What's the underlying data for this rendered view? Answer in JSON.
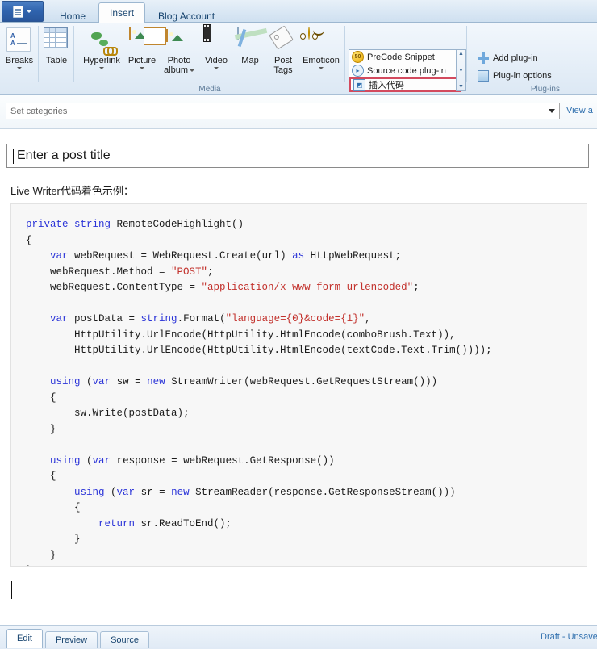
{
  "window": {
    "app_menu_icon": "document-menu-icon",
    "app_menu_caret": "chevron-down-icon"
  },
  "tabs": [
    {
      "label": "Home",
      "active": false
    },
    {
      "label": "Insert",
      "active": true
    },
    {
      "label": "Blog Account",
      "active": false
    }
  ],
  "ribbon": {
    "groups": [
      {
        "name": "breaks",
        "label": "",
        "items": [
          {
            "label": "Breaks",
            "icon": "breaks-icon",
            "dropdown": true
          }
        ]
      },
      {
        "name": "table",
        "label": "",
        "items": [
          {
            "label": "Table",
            "icon": "table-icon",
            "dropdown": false
          }
        ]
      },
      {
        "name": "media",
        "label": "Media",
        "items": [
          {
            "label": "Hyperlink",
            "icon": "hyperlink-globe-icon",
            "dropdown": true
          },
          {
            "label": "Picture",
            "icon": "picture-icon",
            "dropdown": true
          },
          {
            "label": "Photo album",
            "icon": "photo-album-icon",
            "dropdown": true
          },
          {
            "label": "Video",
            "icon": "video-icon",
            "dropdown": true
          },
          {
            "label": "Map",
            "icon": "map-icon",
            "dropdown": false
          },
          {
            "label": "Post Tags",
            "icon": "tag-icon",
            "dropdown": false
          },
          {
            "label": "Emoticon",
            "icon": "emoticon-icon",
            "dropdown": true
          }
        ]
      }
    ],
    "plugins": {
      "label": "Plug-ins",
      "gallery": [
        {
          "label": "PreCode Snippet",
          "icon": "precode-snippet-icon",
          "badge": "50",
          "selected": false
        },
        {
          "label": "Source code plug-in",
          "icon": "source-code-plugin-icon",
          "badge": "",
          "selected": false
        },
        {
          "label": "插入代码",
          "icon": "insert-code-plugin-icon",
          "badge": "",
          "selected": true
        }
      ],
      "scroll": {
        "up": "▲",
        "down": "▼",
        "more": "▼"
      },
      "buttons": [
        {
          "label": "Add plug-in",
          "icon": "add-plugin-icon"
        },
        {
          "label": "Plug-in options",
          "icon": "plugin-options-icon"
        }
      ]
    }
  },
  "categories": {
    "value": "Set categories",
    "dropdown_icon": "chevron-down-icon",
    "view_all_label": "View a"
  },
  "post": {
    "title_placeholder": "Enter a post title",
    "intro_text": "Live Writer代码着色示例：",
    "code_lines": [
      {
        "segments": [
          {
            "t": "private ",
            "c": "kw"
          },
          {
            "t": "string ",
            "c": "kw"
          },
          {
            "t": "RemoteCodeHighlight()",
            "c": ""
          }
        ]
      },
      {
        "segments": [
          {
            "t": "{",
            "c": ""
          }
        ]
      },
      {
        "segments": [
          {
            "t": "    ",
            "c": ""
          },
          {
            "t": "var ",
            "c": "kw"
          },
          {
            "t": "webRequest = WebRequest.Create(url) ",
            "c": ""
          },
          {
            "t": "as ",
            "c": "kw"
          },
          {
            "t": "HttpWebRequest;",
            "c": ""
          }
        ]
      },
      {
        "segments": [
          {
            "t": "    webRequest.Method = ",
            "c": ""
          },
          {
            "t": "\"POST\"",
            "c": "str"
          },
          {
            "t": ";",
            "c": ""
          }
        ]
      },
      {
        "segments": [
          {
            "t": "    webRequest.ContentType = ",
            "c": ""
          },
          {
            "t": "\"application/x-www-form-urlencoded\"",
            "c": "str"
          },
          {
            "t": ";",
            "c": ""
          }
        ]
      },
      {
        "segments": []
      },
      {
        "segments": [
          {
            "t": "    ",
            "c": ""
          },
          {
            "t": "var ",
            "c": "kw"
          },
          {
            "t": "postData = ",
            "c": ""
          },
          {
            "t": "string",
            "c": "kw"
          },
          {
            "t": ".Format(",
            "c": ""
          },
          {
            "t": "\"language={0}&code={1}\"",
            "c": "str"
          },
          {
            "t": ",",
            "c": ""
          }
        ]
      },
      {
        "segments": [
          {
            "t": "        HttpUtility.UrlEncode(HttpUtility.HtmlEncode(comboBrush.Text)),",
            "c": ""
          }
        ]
      },
      {
        "segments": [
          {
            "t": "        HttpUtility.UrlEncode(HttpUtility.HtmlEncode(textCode.Text.Trim())));",
            "c": ""
          }
        ]
      },
      {
        "segments": []
      },
      {
        "segments": [
          {
            "t": "    ",
            "c": ""
          },
          {
            "t": "using ",
            "c": "kw"
          },
          {
            "t": "(",
            "c": ""
          },
          {
            "t": "var ",
            "c": "kw"
          },
          {
            "t": "sw = ",
            "c": ""
          },
          {
            "t": "new ",
            "c": "kw"
          },
          {
            "t": "StreamWriter(webRequest.GetRequestStream()))",
            "c": ""
          }
        ]
      },
      {
        "segments": [
          {
            "t": "    {",
            "c": ""
          }
        ]
      },
      {
        "segments": [
          {
            "t": "        sw.Write(postData);",
            "c": ""
          }
        ]
      },
      {
        "segments": [
          {
            "t": "    }",
            "c": ""
          }
        ]
      },
      {
        "segments": []
      },
      {
        "segments": [
          {
            "t": "    ",
            "c": ""
          },
          {
            "t": "using ",
            "c": "kw"
          },
          {
            "t": "(",
            "c": ""
          },
          {
            "t": "var ",
            "c": "kw"
          },
          {
            "t": "response = webRequest.GetResponse())",
            "c": ""
          }
        ]
      },
      {
        "segments": [
          {
            "t": "    {",
            "c": ""
          }
        ]
      },
      {
        "segments": [
          {
            "t": "        ",
            "c": ""
          },
          {
            "t": "using ",
            "c": "kw"
          },
          {
            "t": "(",
            "c": ""
          },
          {
            "t": "var ",
            "c": "kw"
          },
          {
            "t": "sr = ",
            "c": ""
          },
          {
            "t": "new ",
            "c": "kw"
          },
          {
            "t": "StreamReader(response.GetResponseStream()))",
            "c": ""
          }
        ]
      },
      {
        "segments": [
          {
            "t": "        {",
            "c": ""
          }
        ]
      },
      {
        "segments": [
          {
            "t": "            ",
            "c": ""
          },
          {
            "t": "return ",
            "c": "kw"
          },
          {
            "t": "sr.ReadToEnd();",
            "c": ""
          }
        ]
      },
      {
        "segments": [
          {
            "t": "        }",
            "c": ""
          }
        ]
      },
      {
        "segments": [
          {
            "t": "    }",
            "c": ""
          }
        ]
      },
      {
        "segments": [
          {
            "t": "}",
            "c": ""
          }
        ]
      }
    ]
  },
  "statusbar": {
    "view_tabs": [
      {
        "label": "Edit",
        "active": true
      },
      {
        "label": "Preview",
        "active": false
      },
      {
        "label": "Source",
        "active": false
      }
    ],
    "draft_status": "Draft - Unsave"
  },
  "colors": {
    "accent_blue": "#2f6fae",
    "selection_red": "#d34a5e",
    "keyword_blue": "#2b34d8",
    "string_red": "#c2302b",
    "code_bg": "#f7f7f7"
  }
}
